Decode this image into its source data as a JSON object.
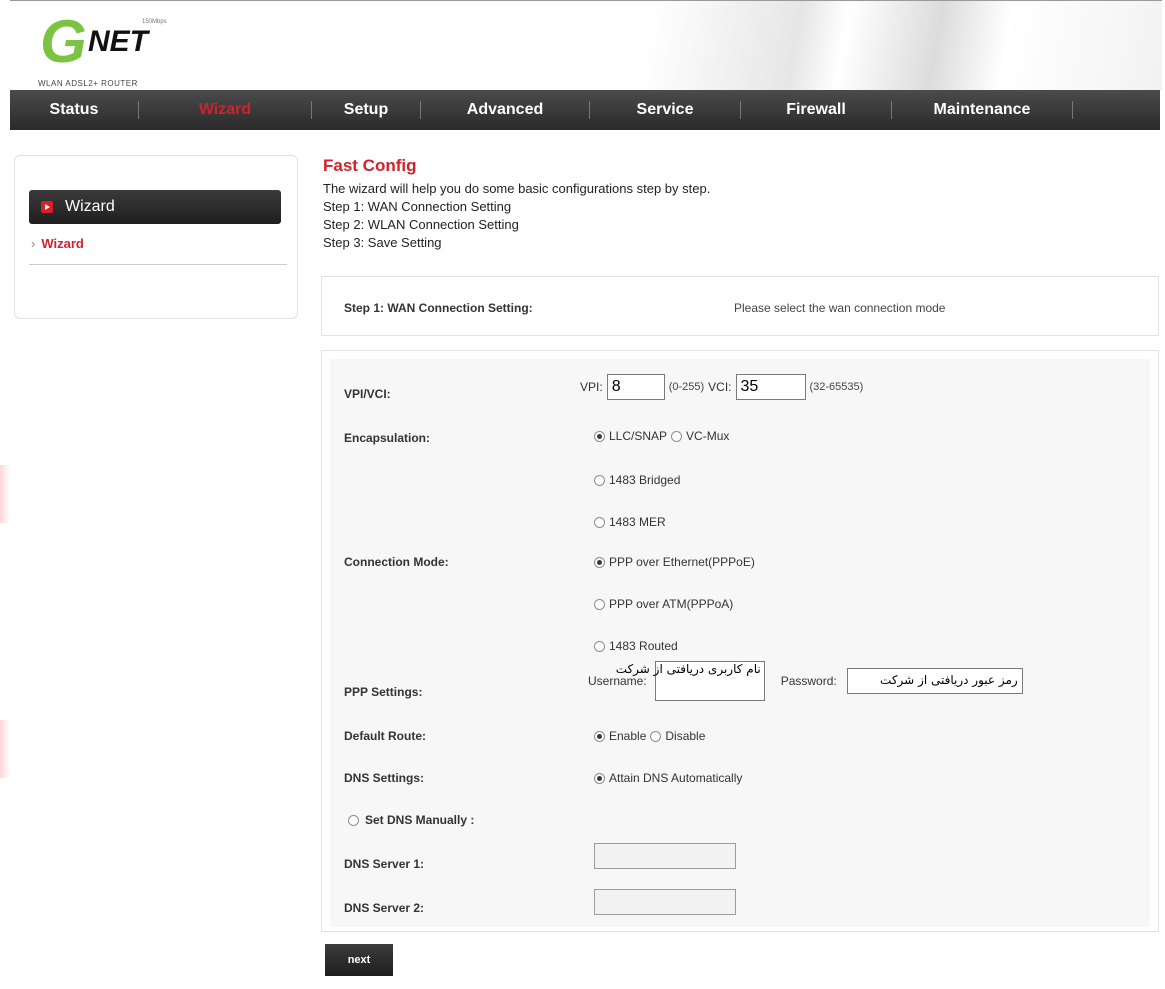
{
  "brand": {
    "logo_g": "G",
    "logo_net": "NET",
    "logo_speed": "150Mbps",
    "logo_sub": "WLAN ADSL2+ ROUTER",
    "accent": "#d3202a",
    "logo_green": "#7cc243"
  },
  "nav": {
    "items": [
      {
        "label": "Status",
        "active": false
      },
      {
        "label": "Wizard",
        "active": true
      },
      {
        "label": "Setup",
        "active": false
      },
      {
        "label": "Advanced",
        "active": false
      },
      {
        "label": "Service",
        "active": false
      },
      {
        "label": "Firewall",
        "active": false
      },
      {
        "label": "Maintenance",
        "active": false
      }
    ]
  },
  "sidebar": {
    "heading": "Wizard",
    "link": "Wizard",
    "link_chevron": "›"
  },
  "intro": {
    "title": "Fast Config",
    "desc": "The wizard will help you do some basic configurations step by step.",
    "step1": "Step 1: WAN Connection Setting",
    "step2": "Step 2: WLAN Connection Setting",
    "step3": "Step 3: Save Setting"
  },
  "step_box": {
    "label": "Step 1: WAN Connection Setting:",
    "note": "Please select the wan connection mode"
  },
  "form": {
    "vpi_vci_label": "VPI/VCI:",
    "vpi_label": "VPI:",
    "vpi_value": "8",
    "vpi_range": "(0-255)",
    "vci_label": "VCI:",
    "vci_value": "35",
    "vci_range": "(32-65535)",
    "encapsulation_label": "Encapsulation:",
    "encap_llc": "LLC/SNAP",
    "encap_vcmux": "VC-Mux",
    "connection_mode_label": "Connection Mode:",
    "mode_bridged": "1483 Bridged",
    "mode_mer": "1483 MER",
    "mode_pppoe": "PPP over Ethernet(PPPoE)",
    "mode_pppoa": "PPP over ATM(PPPoA)",
    "mode_routed": "1483 Routed",
    "ppp_label": "PPP Settings:",
    "username_label": "Username:",
    "username_value": "نام کاربری دریافتی از شرکت",
    "password_label": "Password:",
    "password_value": "رمز عبور دریافتی از شرکت",
    "default_route_label": "Default Route:",
    "route_enable": "Enable",
    "route_disable": "Disable",
    "dns_label": "DNS Settings:",
    "dns_auto": "Attain DNS Automatically",
    "dns_manual": "Set DNS Manually :",
    "dns1_label": "DNS Server 1:",
    "dns2_label": "DNS Server 2:",
    "dns1_value": "",
    "dns2_value": ""
  },
  "next_button": "next"
}
